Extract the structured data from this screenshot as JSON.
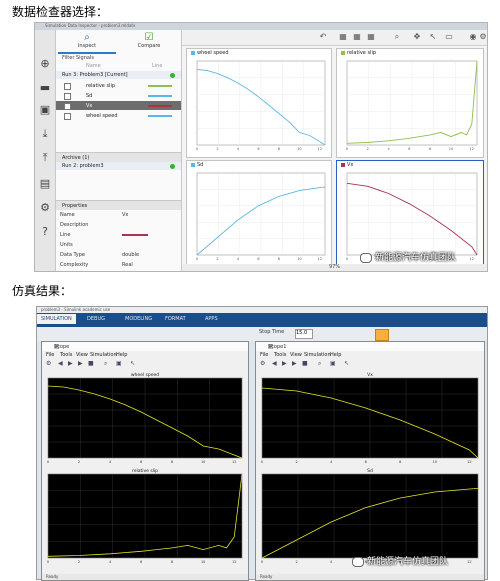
{
  "headings": {
    "top": "数据检查器选择：",
    "bottom": "仿真结果："
  },
  "sdi": {
    "window_title": "Simulation Data Inspector - problem3.mldatx",
    "tabs": [
      {
        "label": "Inspect",
        "icon": "search-icon"
      },
      {
        "label": "Compare",
        "icon": "check-icon"
      }
    ],
    "filter_label": "Filter Signals",
    "col_headers": [
      "Name",
      "Line"
    ],
    "run_current": "Run 3: Problem3 [Current]",
    "signals": [
      {
        "name": "relative slip",
        "checked": false,
        "color": "#8fbf4d"
      },
      {
        "name": "Sd",
        "checked": false,
        "color": "#5bb8e6"
      },
      {
        "name": "Vx",
        "checked": true,
        "color": "#a8334a"
      },
      {
        "name": "wheel speed",
        "checked": false,
        "color": "#5bb8e6"
      }
    ],
    "archive_label": "Archive (1)",
    "archive_run": "Run 2: problem3",
    "properties_label": "Properties",
    "properties": [
      {
        "k": "Name",
        "v": "Vx"
      },
      {
        "k": "Description",
        "v": ""
      },
      {
        "k": "Line",
        "v": ""
      },
      {
        "k": "Units",
        "v": ""
      },
      {
        "k": "Data Type",
        "v": "double"
      },
      {
        "k": "Complexity",
        "v": "Real"
      }
    ],
    "zoom": "97%",
    "plot_titles": {
      "wheel": "wheel speed",
      "slip": "relative slip",
      "sd": "Sd",
      "vx": "Vx"
    },
    "colors": {
      "wheel": "#5bb8e6",
      "slip": "#8fbf4d",
      "sd": "#5bb8e6",
      "vx": "#a8334a"
    }
  },
  "sim": {
    "window_title": "problem3 - Simulink academic use",
    "ribbon_tabs": [
      "SIMULATION",
      "DEBUG",
      "MODELING",
      "FORMAT",
      "APPS"
    ],
    "stop_time_label": "Stop Time",
    "stop_time_value": "15.0",
    "scope_left": {
      "title": "Scope",
      "menu": [
        "File",
        "Tools",
        "View",
        "Simulation",
        "Help"
      ],
      "plot1_title": "wheel speed",
      "plot2_title": "relative slip",
      "status": "Ready"
    },
    "scope_right": {
      "title": "Scope1",
      "menu": [
        "File",
        "Tools",
        "View",
        "Simulation",
        "Help"
      ],
      "plot1_title": "Vx",
      "plot2_title": "Sd",
      "status": "Ready"
    },
    "trace_color": "#e4e42a",
    "bg_color": "#000000"
  },
  "watermark": "新能源汽车仿真团队",
  "chart_data": [
    {
      "type": "line",
      "title": "wheel speed",
      "x": [
        0,
        1,
        2,
        3,
        4,
        5,
        6,
        7,
        8,
        9,
        10,
        11,
        12,
        12.5
      ],
      "y": [
        72,
        71,
        68,
        64,
        59,
        53,
        46,
        38,
        30,
        22,
        12,
        9,
        3,
        0
      ],
      "xlim": [
        0,
        12.5
      ],
      "ylim": [
        0,
        80
      ]
    },
    {
      "type": "line",
      "title": "relative slip",
      "x": [
        0,
        2,
        4,
        6,
        7,
        8,
        9,
        10,
        11,
        11.5,
        12,
        12.5
      ],
      "y": [
        0.02,
        0.03,
        0.05,
        0.08,
        0.1,
        0.12,
        0.15,
        0.1,
        0.15,
        0.12,
        0.25,
        1.0
      ],
      "xlim": [
        0,
        12.5
      ],
      "ylim": [
        0,
        1.0
      ]
    },
    {
      "type": "line",
      "title": "Sd",
      "x": [
        0,
        2,
        4,
        6,
        8,
        10,
        12,
        12.5
      ],
      "y": [
        0,
        150,
        300,
        420,
        500,
        550,
        575,
        580
      ],
      "xlim": [
        0,
        12.5
      ],
      "ylim": [
        0,
        700
      ]
    },
    {
      "type": "line",
      "title": "Vx",
      "x": [
        0,
        2,
        4,
        6,
        8,
        10,
        12,
        12.5
      ],
      "y": [
        70,
        67,
        60,
        50,
        38,
        24,
        8,
        0
      ],
      "xlim": [
        0,
        12.5
      ],
      "ylim": [
        0,
        80
      ]
    }
  ]
}
